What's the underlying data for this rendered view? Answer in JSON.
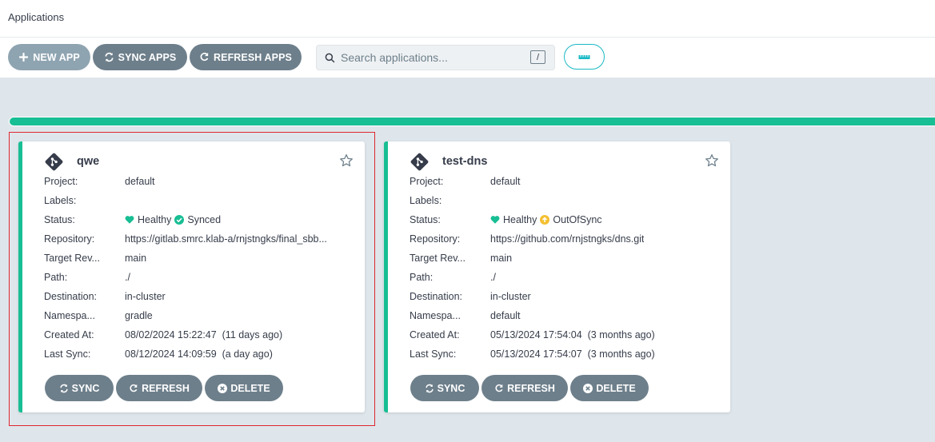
{
  "header": {
    "title": "Applications"
  },
  "toolbar": {
    "new_app": "NEW APP",
    "sync_apps": "SYNC APPS",
    "refresh_apps": "REFRESH APPS",
    "search_placeholder": "Search applications...",
    "search_shortcut": "/"
  },
  "colors": {
    "accent": "#18be94",
    "button": "#6d7f8b",
    "healthy": "#18be94",
    "outofsync": "#f4c030",
    "toggle": "#1ab9c4",
    "selection": "#e0262e"
  },
  "labels": {
    "project": "Project:",
    "labels": "Labels:",
    "status": "Status:",
    "repository": "Repository:",
    "target_rev": "Target Rev...",
    "path": "Path:",
    "destination": "Destination:",
    "namespace": "Namespa...",
    "created_at": "Created At:",
    "last_sync": "Last Sync:"
  },
  "actions": {
    "sync": "SYNC",
    "refresh": "REFRESH",
    "delete": "DELETE"
  },
  "apps": [
    {
      "name": "qwe",
      "project": "default",
      "labels": "",
      "health": "Healthy",
      "sync_status": "Synced",
      "repository": "https://gitlab.smrc.klab-a/rnjstngks/final_sbb...",
      "target_rev": "main",
      "path": "./",
      "destination": "in-cluster",
      "namespace": "gradle",
      "created_at": "08/02/2024 15:22:47  (11 days ago)",
      "last_sync": "08/12/2024 14:09:59  (a day ago)"
    },
    {
      "name": "test-dns",
      "project": "default",
      "labels": "",
      "health": "Healthy",
      "sync_status": "OutOfSync",
      "repository": "https://github.com/rnjstngks/dns.git",
      "target_rev": "main",
      "path": "./",
      "destination": "in-cluster",
      "namespace": "default",
      "created_at": "05/13/2024 17:54:04  (3 months ago)",
      "last_sync": "05/13/2024 17:54:07  (3 months ago)"
    }
  ]
}
